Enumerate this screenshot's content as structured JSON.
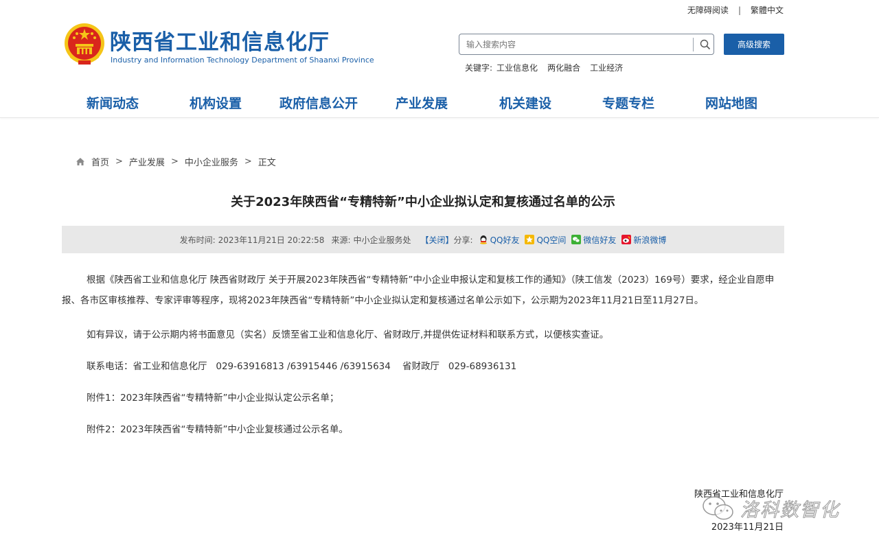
{
  "utility": {
    "accessible": "无障碍阅读",
    "separator": "|",
    "traditional": "繁體中文"
  },
  "header": {
    "title": "陕西省工业和信息化厅",
    "subtitle": "Industry and Information Technology Department of Shaanxi Province"
  },
  "search": {
    "placeholder": "输入搜索内容",
    "advanced_label": "高级搜索",
    "keywords_label": "关键字:",
    "keywords": [
      "工业信息化",
      "两化融合",
      "工业经济"
    ]
  },
  "nav": [
    "新闻动态",
    "机构设置",
    "政府信息公开",
    "产业发展",
    "机关建设",
    "专题专栏",
    "网站地图"
  ],
  "breadcrumb": {
    "items": [
      "首页",
      "产业发展",
      "中小企业服务",
      "正文"
    ],
    "separator": ">"
  },
  "article": {
    "title": "关于2023年陕西省“专精特新”中小企业拟认定和复核通过名单的公示",
    "meta": {
      "published_label": "发布时间:",
      "published": "2023年11月21日 20:22:58",
      "source_label": "来源:",
      "source": "中小企业服务处",
      "close": "【关闭】",
      "share_label": "分享:",
      "share": [
        "QQ好友",
        "QQ空间",
        "微信好友",
        "新浪微博"
      ]
    },
    "paragraphs": [
      "根据《陕西省工业和信息化厅 陕西省财政厅 关于开展2023年陕西省“专精特新”中小企业申报认定和复核工作的通知》（陕工信发（2023）169号）要求，经企业自愿申报、各市区审核推荐、专家评审等程序，现将2023年陕西省“专精特新”中小企业拟认定和复核通过名单公示如下，公示期为2023年11月21日至11月27日。",
      "如有异议，请于公示期内将书面意见（实名）反馈至省工业和信息化厅、省财政厅,并提供佐证材料和联系方式，以便核实查证。",
      "联系电话：省工业和信息化厅   029-63916813 /63915446 /63915634    省财政厅   029-68936131",
      "附件1：2023年陕西省“专精特新”中小企业拟认定公示名单；",
      "附件2：2023年陕西省“专精特新”中小企业复核通过公示名单。"
    ],
    "signature_org": "陕西省工业和信息化厅",
    "signature_date": "2023年11月21日"
  },
  "watermark": {
    "text": "洛科数智化"
  },
  "colors": {
    "brand": "#1a5fa8",
    "meta_bg": "#e8e8e8",
    "emblem_red": "#d9261c",
    "emblem_gold": "#f5c518"
  }
}
